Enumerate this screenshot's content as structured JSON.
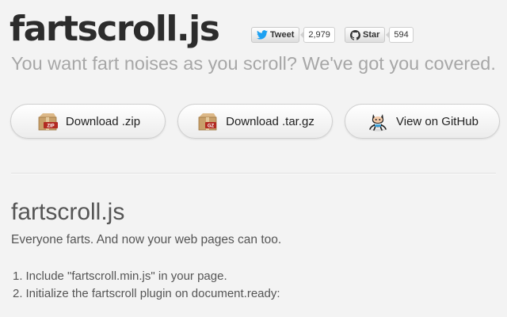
{
  "header": {
    "title": "fartscroll.js",
    "tagline": "You want fart noises as you scroll? We've got you covered."
  },
  "social": {
    "tweet": {
      "label": "Tweet",
      "count": "2,979",
      "icon": "twitter-bird-icon"
    },
    "star": {
      "label": "Star",
      "count": "594",
      "icon": "github-icon"
    }
  },
  "buttons": [
    {
      "label": "Download .zip",
      "badge": "ZIP",
      "icon": "zip-archive-icon"
    },
    {
      "label": "Download .tar.gz",
      "badge": "GZ",
      "icon": "gz-archive-icon"
    },
    {
      "label": "View on GitHub",
      "icon": "octocat-icon"
    }
  ],
  "section": {
    "title": "fartscroll.js",
    "intro": "Everyone farts. And now your web pages can too.",
    "steps": [
      {
        "num": "1.",
        "text": "Include \"fartscroll.min.js\" in your page."
      },
      {
        "num": "2.",
        "text": "Initialize the fartscroll plugin on document.ready:"
      }
    ]
  },
  "colors": {
    "background": "#f3f3f3",
    "title": "#2c2c2c",
    "tagline": "#a7a7a7",
    "twitter_blue": "#1da1f2",
    "archive_tan": "#c8a06a",
    "badge_red": "#b22a22"
  }
}
